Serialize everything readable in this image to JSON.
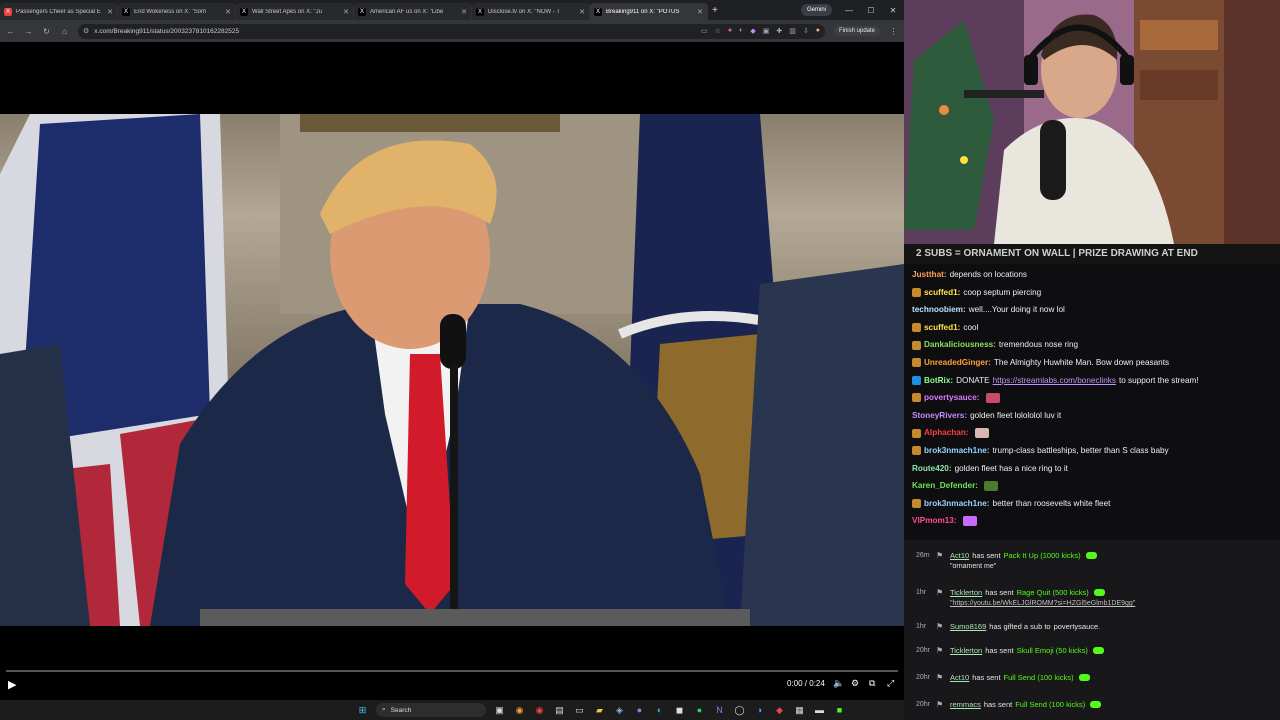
{
  "browser": {
    "tabs": [
      {
        "label": "Passengers Cheer as Special E",
        "favicon": "X",
        "color": "#e8403b"
      },
      {
        "label": "End Wokeness on X: \"Som",
        "favicon": "X",
        "color": "#000000"
      },
      {
        "label": "Wall Street Apes on X: \"Ju",
        "favicon": "X",
        "color": "#000000"
      },
      {
        "label": "American AF us on X: \"Libe",
        "favicon": "X",
        "color": "#000000"
      },
      {
        "label": "Disclose.tv on X: \"NOW - T",
        "favicon": "X",
        "color": "#000000"
      },
      {
        "label": "Breaking911 on X: \"POTUS",
        "favicon": "X",
        "color": "#000000"
      }
    ],
    "new_tab": "+",
    "gemini_label": "Gemini",
    "url": "x.com/Breaking911/status/2003237810162282525",
    "finish_update": "Finish update",
    "video": {
      "time": "0:00 / 0:24",
      "progress": 0
    },
    "taskbar": {
      "search_placeholder": "Search"
    }
  },
  "stream": {
    "banner": "2 SUBS = ORNAMENT ON WALL | PRIZE DRAWING AT END",
    "chat": [
      {
        "user": "Justthat",
        "color": "#ff9f5a",
        "badge": "",
        "text": "depends on locations"
      },
      {
        "user": "scuffed1",
        "color": "#ffe14a",
        "badge": "#c58a2b",
        "text": "coop septum piercing"
      },
      {
        "user": "technoobiem",
        "color": "#b8e3ff",
        "badge": "",
        "text": "well....Your doing it now lol"
      },
      {
        "user": "scuffed1",
        "color": "#ffe14a",
        "badge": "#c58a2b",
        "text": "cool"
      },
      {
        "user": "Dankaliciousness",
        "color": "#8de05b",
        "badge": "#c58a2b",
        "text": "tremendous nose ring"
      },
      {
        "user": "UnreadedGinger",
        "color": "#ff9f3a",
        "badge": "#c58a2b",
        "text": "The Almighty Huwhite Man. Bow down peasants"
      },
      {
        "user": "BotRix",
        "color": "#8dff8d",
        "badge": "#1f8fe0",
        "text": "DONATE",
        "link": "https://streamlabs.com/boneclinks",
        "tail": "to support the stream!"
      },
      {
        "user": "povertysauce",
        "color": "#d77bff",
        "badge": "#c58a2b",
        "text": "",
        "emote": "#c84b6b"
      },
      {
        "user": "StoneyRivers",
        "color": "#c38bff",
        "badge": "",
        "text": "golden fleet lolololol luv it"
      },
      {
        "user": "Alphachan",
        "color": "#ff3d3d",
        "badge": "#c58a2b",
        "text": "",
        "emote": "#d9b7b0"
      },
      {
        "user": "brok3nmach1ne",
        "color": "#9ad3ff",
        "badge": "#c58a2b",
        "text": "trump-class battleships, better than S class baby"
      },
      {
        "user": "Route420",
        "color": "#8ee6a6",
        "badge": "",
        "text": "golden fleet has a nice ring to it"
      },
      {
        "user": "Karen_Defender",
        "color": "#6fe15b",
        "badge": "",
        "text": "",
        "emote": "#4a7a2a"
      },
      {
        "user": "brok3nmach1ne",
        "color": "#9ad3ff",
        "badge": "#c58a2b",
        "text": "better than roosevelts white fleet"
      },
      {
        "user": "VIPmom13",
        "color": "#ff4d8a",
        "badge": "",
        "text": "",
        "emote": "#c76bff"
      }
    ],
    "alerts": [
      {
        "age": "26m",
        "user": "Act10",
        "action": "has sent",
        "gift": "Pack It Up (1000 kicks)",
        "note": "\"ornament me\""
      },
      {
        "age": "1hr",
        "user": "Ticklerton",
        "action": "has sent",
        "gift": "Rage Quit (500 kicks)",
        "note": "\"https://youtu.be/WkELJGlROMM?si=HZGl5eGlmb1DE9gg\""
      },
      {
        "age": "1hr",
        "user": "Sumo8169",
        "action": "has gifted a sub to",
        "target": "povertysauce."
      },
      {
        "age": "20hr",
        "user": "Ticklerton",
        "action": "has sent",
        "gift": "Skull Emoji (50 kicks)"
      },
      {
        "age": "20hr",
        "user": "Act10",
        "action": "has sent",
        "gift": "Full Send (100 kicks)"
      },
      {
        "age": "20hr",
        "user": "remmacs",
        "action": "has sent",
        "gift": "Full Send (100 kicks)"
      }
    ]
  }
}
